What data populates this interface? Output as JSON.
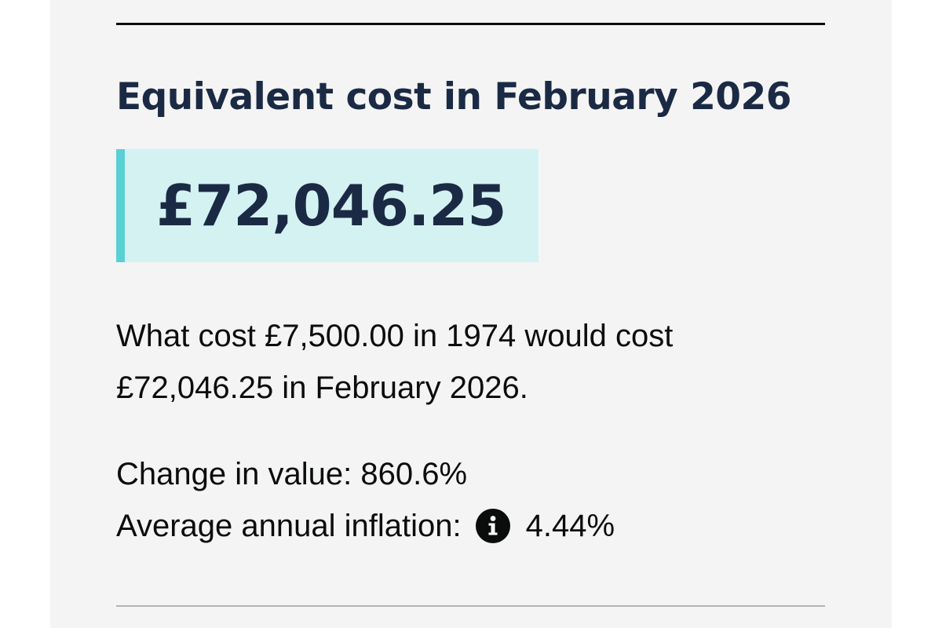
{
  "result": {
    "heading": "Equivalent cost in February 2026",
    "value": "£72,046.25"
  },
  "summary": {
    "line1": "What cost £7,500.00 in 1974 would cost",
    "line2": "£72,046.25 in February 2026."
  },
  "stats": {
    "change_label": "Change in value:",
    "change_value": "860.6%",
    "inflation_label": "Average annual inflation:",
    "inflation_value": "4.44%",
    "info_icon": "info-icon"
  },
  "colors": {
    "heading_text": "#1b2a44",
    "result_background": "#d4f2f2",
    "result_accent_border": "#5ad0d4",
    "panel_background": "#f4f4f4",
    "body_text": "#0b0c0c"
  }
}
